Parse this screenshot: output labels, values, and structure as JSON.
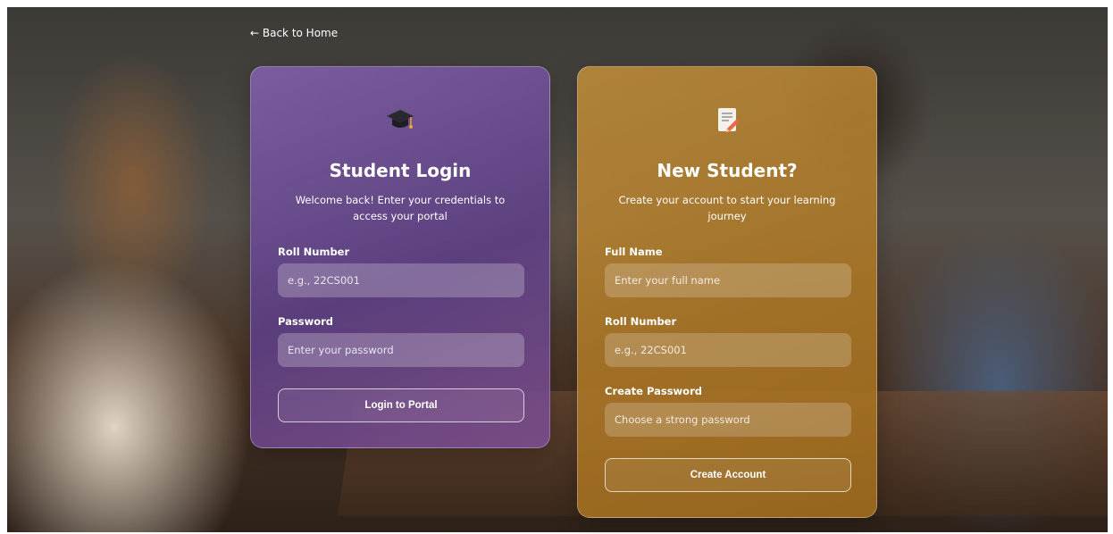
{
  "nav": {
    "back_label": "← Back to Home"
  },
  "login": {
    "icon": "graduation-cap-icon",
    "title": "Student Login",
    "subtitle": "Welcome back! Enter your credentials to access your portal",
    "roll_label": "Roll Number",
    "roll_placeholder": "e.g., 22CS001",
    "password_label": "Password",
    "password_placeholder": "Enter your password",
    "button_label": "Login to Portal",
    "accent": "#6e4c9c"
  },
  "register": {
    "icon": "notepad-pencil-icon",
    "title": "New Student?",
    "subtitle": "Create your account to start your learning journey",
    "name_label": "Full Name",
    "name_placeholder": "Enter your full name",
    "roll_label": "Roll Number",
    "roll_placeholder": "e.g., 22CS001",
    "password_label": "Create Password",
    "password_placeholder": "Choose a strong password",
    "button_label": "Create Account",
    "accent": "#b4822a"
  }
}
